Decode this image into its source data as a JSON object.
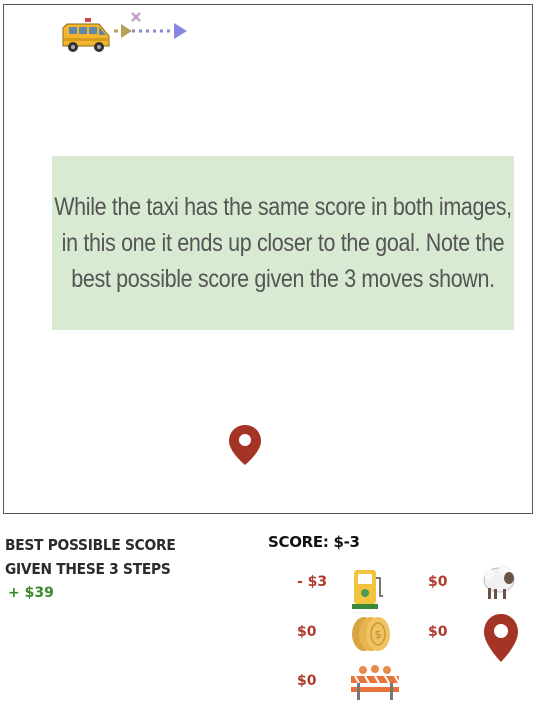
{
  "board": {
    "tooltip_text": "While the taxi has the same score in both images, in this one it ends up closer to the goal. Note the best possible score given the 3 moves shown."
  },
  "icons": {
    "taxi": "taxi-icon",
    "path": "path-arrow-icon",
    "goal": "location-pin-icon",
    "fuel": "fuel-pump-icon",
    "coins": "coin-stack-icon",
    "roadblock": "roadblock-icon",
    "sheep": "sheep-icon"
  },
  "summary": {
    "best_title_line1": "BEST POSSIBLE SCORE",
    "best_title_line2": "GIVEN THESE 3 STEPS",
    "best_value": "+ $39",
    "score_label": "SCORE: $-3"
  },
  "legend": {
    "fuel_value": "- $3",
    "coins_value": "$0",
    "roadblock_value": "$0",
    "sheep_value": "$0",
    "goal_value": "$0"
  },
  "colors": {
    "tooltip_bg": "#d9ead3",
    "pin": "#a33426",
    "negative": "#b03a2e",
    "positive": "#3a8a2a"
  }
}
